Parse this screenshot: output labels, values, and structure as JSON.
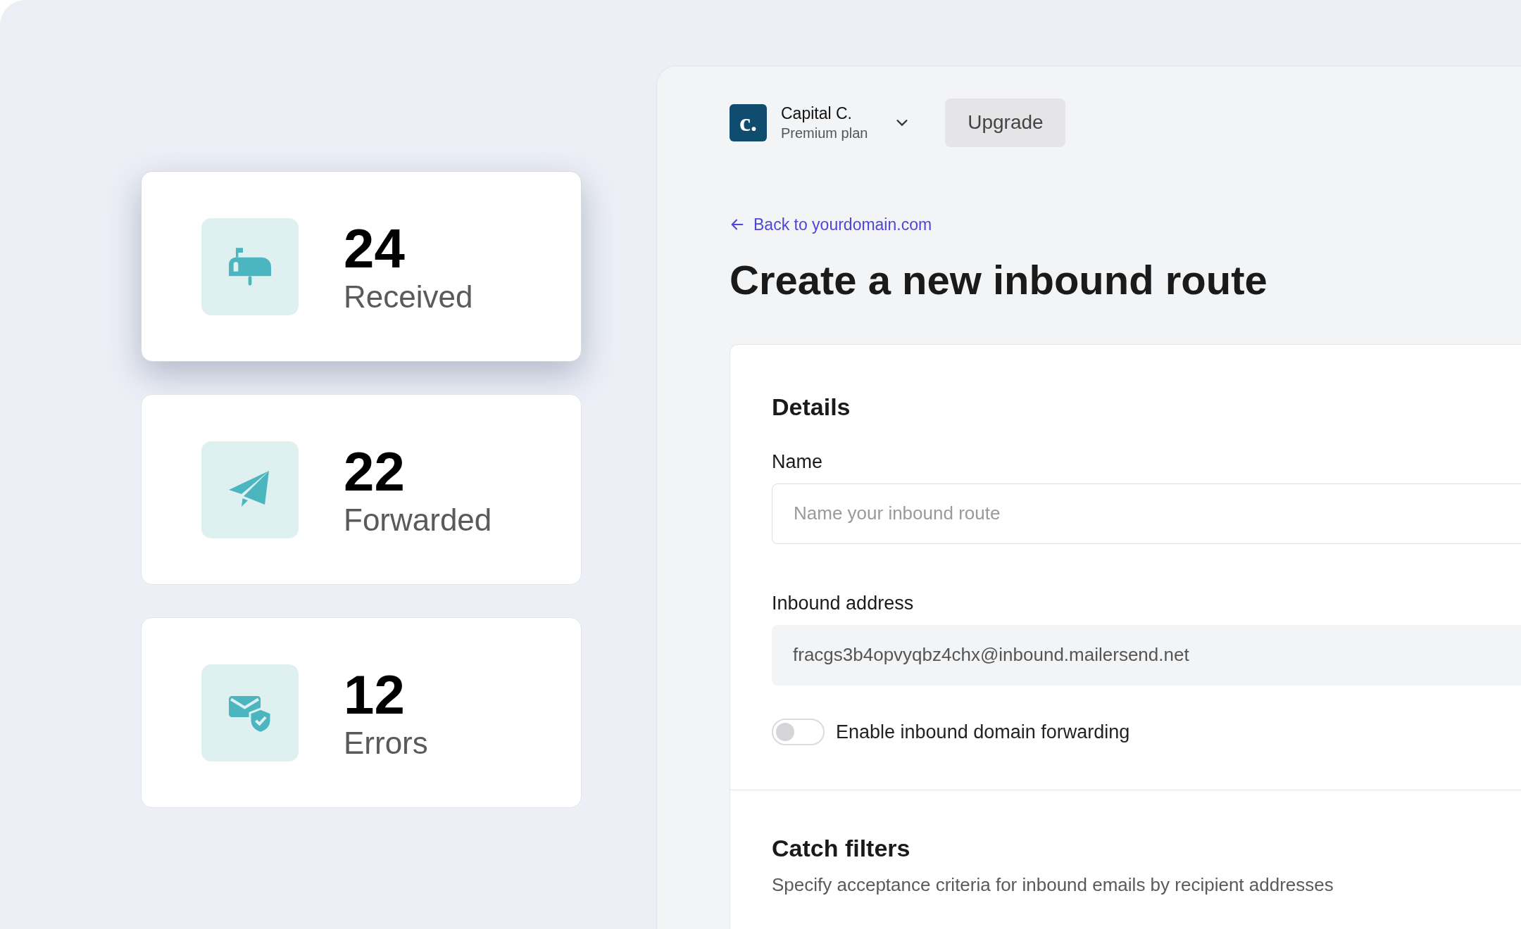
{
  "stats": [
    {
      "kind": "mailbox",
      "value": "24",
      "label": "Received",
      "selected": true
    },
    {
      "kind": "plane",
      "value": "22",
      "label": "Forwarded",
      "selected": false
    },
    {
      "kind": "shield-mail",
      "value": "12",
      "label": "Errors",
      "selected": false
    }
  ],
  "account": {
    "logo_text": "c.",
    "name": "Capital C.",
    "plan": "Premium plan"
  },
  "upgrade_button": "Upgrade",
  "back_link": "Back to yourdomain.com",
  "title": "Create a new inbound route",
  "details": {
    "heading": "Details",
    "name_field": {
      "label": "Name",
      "placeholder": "Name your inbound route"
    },
    "address_field": {
      "label": "Inbound address",
      "value": "fracgs3b4opvyqbz4chx@inbound.mailersend.net"
    },
    "forwarding_toggle": {
      "label": "Enable inbound domain forwarding",
      "on": false
    }
  },
  "catch_filters": {
    "heading": "Catch filters",
    "description": "Specify acceptance criteria for inbound emails by recipient addresses"
  }
}
